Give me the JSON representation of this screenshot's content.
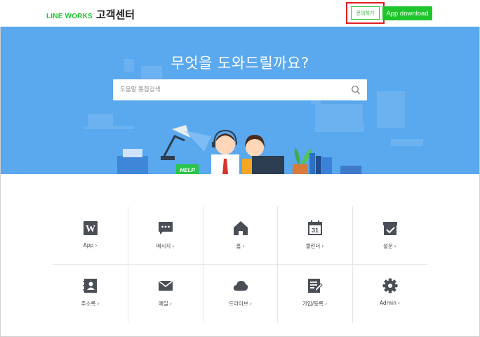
{
  "header": {
    "brand": "LINE WORKS",
    "subtitle": "고객센터",
    "inquiry_label": "문의하기",
    "download_label": "App download"
  },
  "hero": {
    "title": "무엇을 도와드릴까요?",
    "search_placeholder": "도움말 통합검색",
    "help_sign": "HELP",
    "calendar_day": "31"
  },
  "menu": [
    {
      "label": "App",
      "icon": "app-icon"
    },
    {
      "label": "메시지",
      "icon": "message-icon"
    },
    {
      "label": "홈",
      "icon": "home-icon"
    },
    {
      "label": "캘린더",
      "icon": "calendar-icon"
    },
    {
      "label": "설문",
      "icon": "survey-icon"
    },
    {
      "label": "주소록",
      "icon": "contacts-icon"
    },
    {
      "label": "메일",
      "icon": "mail-icon"
    },
    {
      "label": "드라이브",
      "icon": "drive-icon"
    },
    {
      "label": "가입/등록",
      "icon": "signup-icon"
    },
    {
      "label": "Admin",
      "icon": "admin-icon"
    }
  ],
  "colors": {
    "brand_green": "#1ec52b",
    "hero_blue": "#5aa8ee",
    "icon_gray": "#4a4f57",
    "highlight_red": "#e02020"
  }
}
